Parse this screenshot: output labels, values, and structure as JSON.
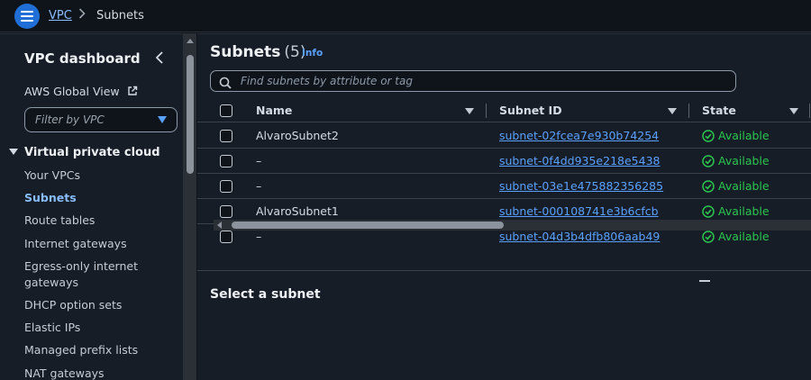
{
  "breadcrumb": {
    "service": "VPC",
    "current": "Subnets"
  },
  "sidebar": {
    "title": "VPC dashboard",
    "global_view": "AWS Global View",
    "filter_placeholder": "Filter by VPC",
    "section": "Virtual private cloud",
    "items": [
      {
        "label": "Your VPCs",
        "active": false
      },
      {
        "label": "Subnets",
        "active": true
      },
      {
        "label": "Route tables",
        "active": false
      },
      {
        "label": "Internet gateways",
        "active": false
      },
      {
        "label": "Egress-only internet gateways",
        "active": false
      },
      {
        "label": "DHCP option sets",
        "active": false
      },
      {
        "label": "Elastic IPs",
        "active": false
      },
      {
        "label": "Managed prefix lists",
        "active": false
      },
      {
        "label": "NAT gateways",
        "active": false
      }
    ]
  },
  "main": {
    "title": "Subnets",
    "count": "(5)",
    "info_label": "Info",
    "search_placeholder": "Find subnets by attribute or tag",
    "columns": [
      "Name",
      "Subnet ID",
      "State"
    ],
    "rows": [
      {
        "name": "AlvaroSubnet2",
        "subnet_id": "subnet-02fcea7e930b74254",
        "state": "Available"
      },
      {
        "name": "–",
        "subnet_id": "subnet-0f4dd935e218e5438",
        "state": "Available"
      },
      {
        "name": "–",
        "subnet_id": "subnet-03e1e475882356285",
        "state": "Available"
      },
      {
        "name": "AlvaroSubnet1",
        "subnet_id": "subnet-000108741e3b6cfcb",
        "state": "Available"
      },
      {
        "name": "–",
        "subnet_id": "subnet-04d3b4dfb806aab49",
        "state": "Available"
      }
    ],
    "detail_title": "Select a subnet"
  },
  "colors": {
    "accent": "#5aa0ff",
    "available": "#2bc64f",
    "menu_button": "#1f6fd6"
  },
  "icons": [
    "menu-icon",
    "chevron-right-icon",
    "chevron-left-icon",
    "external-link-icon",
    "caret-down-icon",
    "search-icon",
    "check-circle-icon"
  ]
}
